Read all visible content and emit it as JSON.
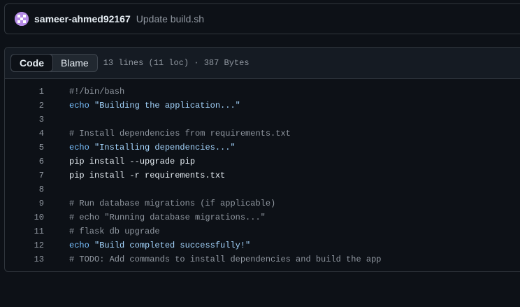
{
  "commit": {
    "author": "sameer-ahmed92167",
    "message": "Update build.sh"
  },
  "file": {
    "tabs": [
      "Code",
      "Blame"
    ],
    "active_tab": "Code",
    "info": "13 lines (11 loc) · 387 Bytes"
  },
  "code_lines": [
    {
      "num": "1",
      "parts": [
        {
          "t": "#!/bin/bash",
          "c": "comment"
        }
      ]
    },
    {
      "num": "2",
      "parts": [
        {
          "t": "echo",
          "c": "kw"
        },
        {
          "t": " ",
          "c": ""
        },
        {
          "t": "\"Building the application...\"",
          "c": "str"
        }
      ]
    },
    {
      "num": "3",
      "parts": []
    },
    {
      "num": "4",
      "parts": [
        {
          "t": "# Install dependencies from requirements.txt",
          "c": "comment"
        }
      ]
    },
    {
      "num": "5",
      "parts": [
        {
          "t": "echo",
          "c": "kw"
        },
        {
          "t": " ",
          "c": ""
        },
        {
          "t": "\"Installing dependencies...\"",
          "c": "str"
        }
      ]
    },
    {
      "num": "6",
      "parts": [
        {
          "t": "pip install --upgrade pip",
          "c": ""
        }
      ]
    },
    {
      "num": "7",
      "parts": [
        {
          "t": "pip install -r requirements.txt",
          "c": ""
        }
      ]
    },
    {
      "num": "8",
      "parts": []
    },
    {
      "num": "9",
      "parts": [
        {
          "t": "# Run database migrations (if applicable)",
          "c": "comment"
        }
      ]
    },
    {
      "num": "10",
      "parts": [
        {
          "t": "# echo \"Running database migrations...\"",
          "c": "comment"
        }
      ]
    },
    {
      "num": "11",
      "parts": [
        {
          "t": "# flask db upgrade",
          "c": "comment"
        }
      ]
    },
    {
      "num": "12",
      "parts": [
        {
          "t": "echo",
          "c": "kw"
        },
        {
          "t": " ",
          "c": ""
        },
        {
          "t": "\"Build completed successfully!\"",
          "c": "str"
        }
      ]
    },
    {
      "num": "13",
      "parts": [
        {
          "t": "# TODO: Add commands to install dependencies and build the app",
          "c": "comment"
        }
      ]
    }
  ]
}
